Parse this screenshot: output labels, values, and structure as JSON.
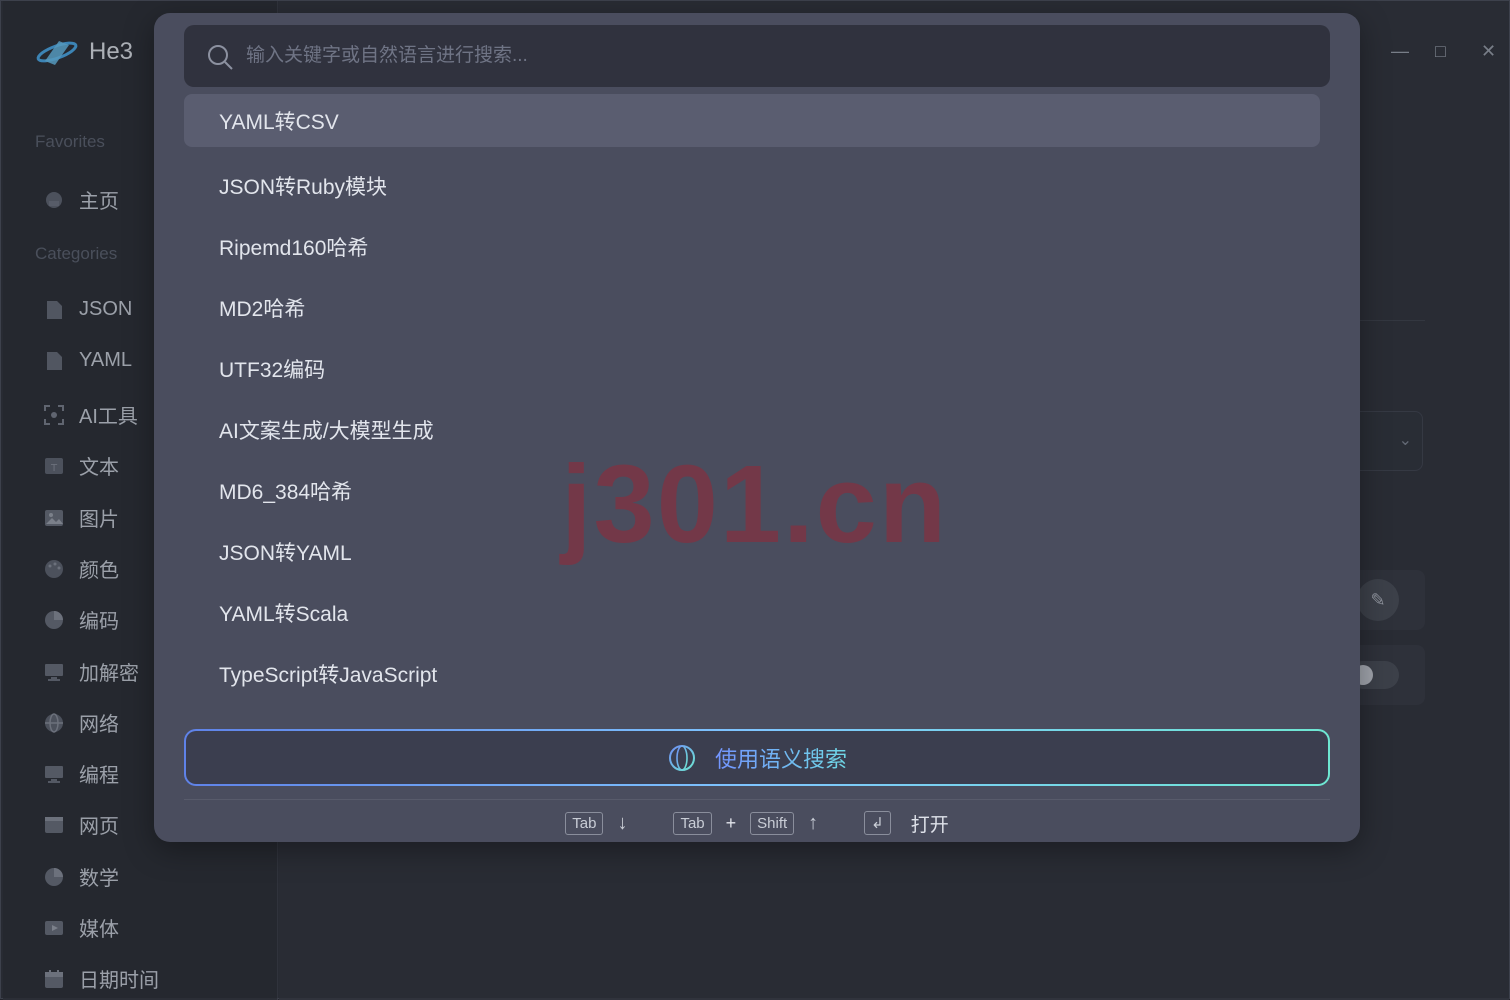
{
  "app": {
    "name": "He3"
  },
  "sidebar": {
    "favorites_label": "Favorites",
    "categories_label": "Categories",
    "favorites": [
      {
        "label": "主页",
        "icon": "home-icon"
      }
    ],
    "categories": [
      {
        "label": "JSON",
        "icon": "file-icon"
      },
      {
        "label": "YAML",
        "icon": "file-icon"
      },
      {
        "label": "AI工具",
        "icon": "scan-icon"
      },
      {
        "label": "文本",
        "icon": "text-icon"
      },
      {
        "label": "图片",
        "icon": "image-icon"
      },
      {
        "label": "颜色",
        "icon": "palette-icon"
      },
      {
        "label": "编码",
        "icon": "pie-icon"
      },
      {
        "label": "加解密",
        "icon": "monitor-code-icon"
      },
      {
        "label": "网络",
        "icon": "globe-icon"
      },
      {
        "label": "编程",
        "icon": "monitor-code-icon"
      },
      {
        "label": "网页",
        "icon": "browser-icon"
      },
      {
        "label": "数学",
        "icon": "pie-icon"
      },
      {
        "label": "媒体",
        "icon": "play-icon"
      },
      {
        "label": "日期时间",
        "icon": "calendar-icon"
      }
    ]
  },
  "window_controls": {
    "minimize": "—",
    "maximize": "□",
    "close": "✕"
  },
  "palette": {
    "search_placeholder": "输入关键字或自然语言进行搜索...",
    "results": [
      "YAML转CSV",
      "JSON转Ruby模块",
      "Ripemd160哈希",
      "MD2哈希",
      "UTF32编码",
      "AI文案生成/大模型生成",
      "MD6_384哈希",
      "JSON转YAML",
      "YAML转Scala",
      "TypeScript转JavaScript"
    ],
    "semantic_search_label": "使用语义搜索",
    "footer": {
      "tab": "Tab",
      "down": "↓",
      "plus": "+",
      "shift": "Shift",
      "up": "↑",
      "enter": "↲",
      "open": "打开"
    }
  },
  "watermark": "j301.cn",
  "colors": {
    "accent_start": "#6f8ff5",
    "accent_end": "#6ee7d2",
    "palette_bg": "#4a4d5e"
  }
}
